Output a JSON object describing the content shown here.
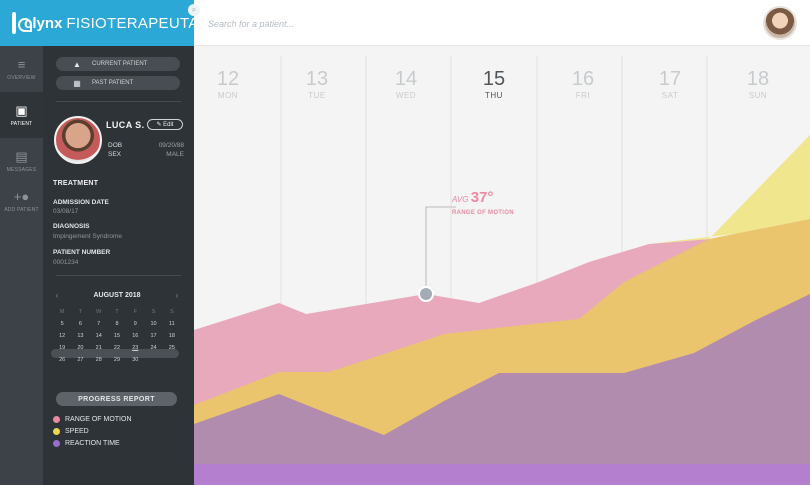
{
  "app": {
    "brand": "clynx",
    "brand_sub": "FISIOTERAPEUTA"
  },
  "search": {
    "placeholder": "Search for a patient..."
  },
  "rail": {
    "items": [
      {
        "label": "OVERVIEW",
        "icon": "list-icon"
      },
      {
        "label": "PATIENT",
        "icon": "folder-patient-icon"
      },
      {
        "label": "MESSAGES",
        "icon": "chat-icon"
      },
      {
        "label": "ADD PATIENT",
        "icon": "add-users-icon"
      }
    ]
  },
  "panel": {
    "current_patient": "CURRENT PATIENT",
    "past_patient": "PAST PATIENT",
    "patient": {
      "name": "LUCA S.",
      "edit": "Edit",
      "dob_label": "DOB",
      "dob_value": "09/20/88",
      "sex_label": "SEX",
      "sex_value": "MALE"
    },
    "treatment": {
      "heading": "TREATMENT",
      "admission_label": "ADMISSION DATE",
      "admission_value": "03/08/17",
      "diagnosis_label": "DIAGNOSIS",
      "diagnosis_value": "Impingement Syndrome",
      "number_label": "PATIENT NUMBER",
      "number_value": "0001234"
    },
    "calendar": {
      "month": "AUGUST 2018",
      "dows": [
        "M",
        "T",
        "W",
        "T",
        "F",
        "S",
        "S"
      ],
      "weeks": [
        [
          "5",
          "6",
          "7",
          "8",
          "9",
          "10",
          "11"
        ],
        [
          "12",
          "13",
          "14",
          "15",
          "16",
          "17",
          "18"
        ],
        [
          "19",
          "20",
          "21",
          "22",
          "23",
          "24",
          "25"
        ],
        [
          "26",
          "27",
          "28",
          "29",
          "30",
          "",
          ""
        ]
      ],
      "today": "23"
    },
    "progress_report": "PROGRESS REPORT",
    "legend": [
      {
        "label": "RANGE OF MOTION",
        "color": "#e98aa3"
      },
      {
        "label": "SPEED",
        "color": "#ecd84a"
      },
      {
        "label": "REACTION TIME",
        "color": "#9b6bd0"
      }
    ]
  },
  "chart": {
    "days": [
      {
        "num": "12",
        "name": "MON"
      },
      {
        "num": "13",
        "name": "TUE"
      },
      {
        "num": "14",
        "name": "WED"
      },
      {
        "num": "15",
        "name": "THU"
      },
      {
        "num": "16",
        "name": "FRI"
      },
      {
        "num": "17",
        "name": "SAT"
      },
      {
        "num": "18",
        "name": "SUN"
      }
    ],
    "active_day": "15",
    "avg_prefix": "AVG",
    "avg_value": "37°",
    "metric_label": "RANGE OF MOTION"
  },
  "colors": {
    "brand": "#2ba8d6",
    "rom": "#e98aa3",
    "speed": "#ecd84a",
    "reaction": "#9b6bd0"
  }
}
